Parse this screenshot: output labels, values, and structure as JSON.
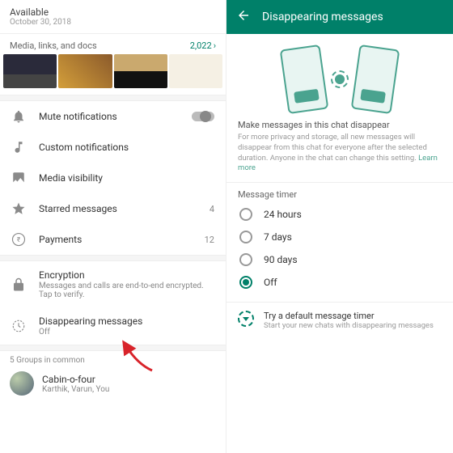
{
  "left": {
    "status": "Available",
    "status_date": "October 30, 2018",
    "media_label": "Media, links, and docs",
    "media_count": "2,022",
    "rows": {
      "mute": {
        "label": "Mute notifications"
      },
      "custom": {
        "label": "Custom notifications"
      },
      "media_vis": {
        "label": "Media visibility"
      },
      "starred": {
        "label": "Starred messages",
        "count": "4"
      },
      "payments": {
        "label": "Payments",
        "count": "12"
      },
      "encryption": {
        "label": "Encryption",
        "sub": "Messages and calls are end-to-end encrypted. Tap to verify."
      },
      "disappearing": {
        "label": "Disappearing messages",
        "sub": "Off"
      }
    },
    "groups_header": "5 Groups in common",
    "group": {
      "name": "Cabin-o-four",
      "members": "Karthik, Varun, You"
    }
  },
  "right": {
    "title": "Disappearing messages",
    "desc_head": "Make messages in this chat disappear",
    "desc_body": "For more privacy and storage, all new messages will disappear from this chat for everyone after the selected duration. Anyone in the chat can change this setting. ",
    "learn_more": "Learn more",
    "timer_label": "Message timer",
    "options": [
      "24 hours",
      "7 days",
      "90 days",
      "Off"
    ],
    "selected": "Off",
    "footer_title": "Try a default message timer",
    "footer_sub": "Start your new chats with disappearing messages"
  }
}
